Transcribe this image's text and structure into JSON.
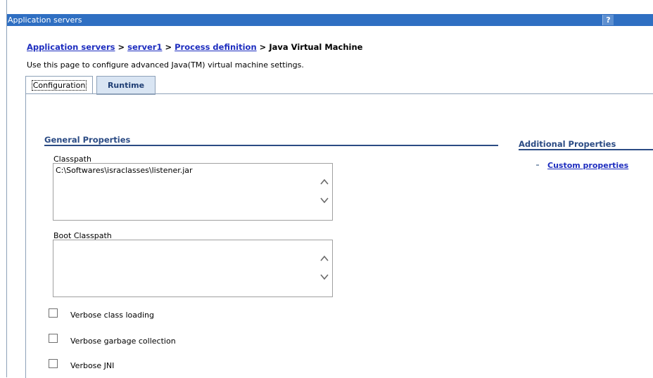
{
  "window": {
    "title": "Application servers",
    "help_label": "?"
  },
  "breadcrumb": {
    "items": [
      "Application servers",
      "server1",
      "Process definition"
    ],
    "separator": ">",
    "current": "Java Virtual Machine"
  },
  "page_description": "Use this page to configure advanced Java(TM) virtual machine settings.",
  "tabs": [
    {
      "label": "Configuration",
      "active": true
    },
    {
      "label": "Runtime",
      "active": false
    }
  ],
  "general_properties": {
    "title": "General Properties",
    "classpath": {
      "label": "Classpath",
      "value": "C:\\Softwares\\israclasses\\listener.jar"
    },
    "boot_classpath": {
      "label": "Boot Classpath",
      "value": ""
    },
    "checkboxes": [
      {
        "label": "Verbose class loading",
        "checked": false
      },
      {
        "label": "Verbose garbage collection",
        "checked": false
      },
      {
        "label": "Verbose JNI",
        "checked": false
      }
    ]
  },
  "additional_properties": {
    "title": "Additional Properties",
    "links": [
      "Custom properties"
    ]
  },
  "colors": {
    "title_bar": "#2f6fc2",
    "link": "#1d2dbf",
    "section_title": "#2b4b84",
    "tab_inactive": "#d9e5f3"
  }
}
